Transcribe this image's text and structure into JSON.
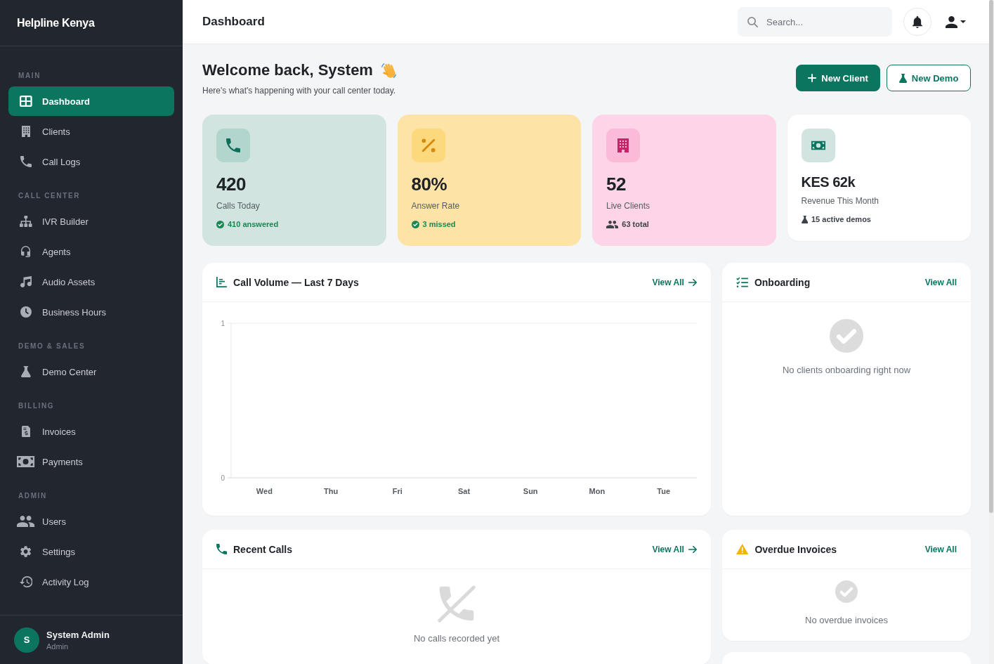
{
  "sidebar": {
    "brand": "Helpline Kenya",
    "sections": [
      {
        "label": "MAIN",
        "items": [
          {
            "label": "Dashboard",
            "selected": true
          },
          {
            "label": "Clients",
            "selected": false
          },
          {
            "label": "Call Logs",
            "selected": false
          }
        ]
      },
      {
        "label": "CALL CENTER",
        "items": [
          {
            "label": "IVR Builder",
            "selected": false
          },
          {
            "label": "Agents",
            "selected": false
          },
          {
            "label": "Audio Assets",
            "selected": false
          },
          {
            "label": "Business Hours",
            "selected": false
          }
        ]
      },
      {
        "label": "DEMO & SALES",
        "items": [
          {
            "label": "Demo Center",
            "selected": false
          }
        ]
      },
      {
        "label": "BILLING",
        "items": [
          {
            "label": "Invoices",
            "selected": false
          },
          {
            "label": "Payments",
            "selected": false
          }
        ]
      },
      {
        "label": "ADMIN",
        "items": [
          {
            "label": "Users",
            "selected": false
          },
          {
            "label": "Settings",
            "selected": false
          },
          {
            "label": "Activity Log",
            "selected": false
          }
        ]
      }
    ],
    "user": {
      "initial": "S",
      "name": "System Admin",
      "role": "Admin"
    }
  },
  "header": {
    "title": "Dashboard",
    "search": {
      "placeholder": "Search..."
    }
  },
  "welcome": {
    "title": "Welcome back, System",
    "subtitle": "Here's what's happening with your call center today.",
    "buttons": [
      {
        "label": "New Client",
        "kind": "primary"
      },
      {
        "label": "New Demo",
        "kind": "outline"
      }
    ]
  },
  "stats": [
    {
      "kind": "metric",
      "color": "#d1e4e0",
      "value": "420",
      "label": "Calls Today",
      "note": {
        "kind": "success",
        "text": "410 answered"
      }
    },
    {
      "kind": "metric",
      "color": "#fde4a6",
      "value": "80%",
      "label": "Answer Rate",
      "note": {
        "kind": "success",
        "text": "3 missed"
      }
    },
    {
      "kind": "metric",
      "color": "#fdd4e8",
      "value": "52",
      "label": "Live Clients",
      "note": {
        "kind": "info",
        "text": "63 total"
      }
    },
    {
      "kind": "summary",
      "color": "#ffffff",
      "value": "KES 62k",
      "label": "Revenue This Month",
      "note": {
        "kind": "info",
        "text": "15 active demos"
      }
    }
  ],
  "call_volume": {
    "title": "Call Volume — Last 7 Days",
    "link": {
      "label": "View All",
      "arrow": true
    },
    "chart_data": {
      "type": "bar",
      "categories": [
        "Wed",
        "Thu",
        "Fri",
        "Sat",
        "Sun",
        "Mon",
        "Tue"
      ],
      "values": [
        0,
        0,
        0,
        0,
        0,
        0,
        0
      ],
      "ylim": [
        0,
        1
      ],
      "yticks": [
        0,
        1
      ]
    }
  },
  "onboarding": {
    "title": "Onboarding",
    "link": {
      "label": "View All",
      "arrow": false
    },
    "empty_message": "No clients onboarding right now"
  },
  "recent_calls": {
    "title": "Recent Calls",
    "link": {
      "label": "View All",
      "arrow": true
    },
    "empty_message": "No calls recorded yet"
  },
  "overdue_invoices": {
    "title": "Overdue Invoices",
    "link": {
      "label": "View All",
      "arrow": false
    },
    "empty_message": "No overdue invoices"
  }
}
